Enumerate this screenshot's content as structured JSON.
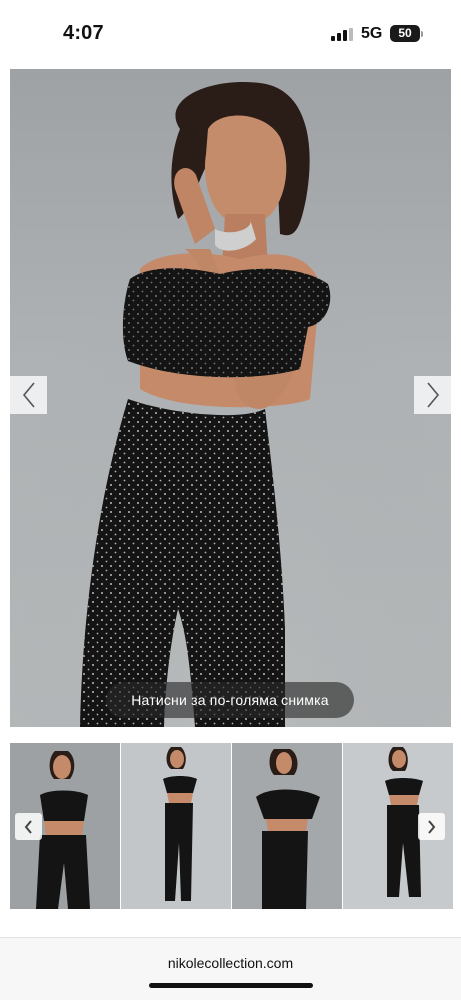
{
  "status_bar": {
    "time": "4:07",
    "network": "5G",
    "battery": "50"
  },
  "gallery": {
    "caption": "Натисни за по-голяма снимка",
    "prev_icon": "chevron-left-icon",
    "next_icon": "chevron-right-icon",
    "thumbnail_count": 4
  },
  "browser": {
    "url": "nikolecollection.com"
  },
  "colors": {
    "background": "#ffffff",
    "caption_bg": "#3a3a3a",
    "outfit": "#141414",
    "studio_backdrop": "#aeb2b4"
  }
}
